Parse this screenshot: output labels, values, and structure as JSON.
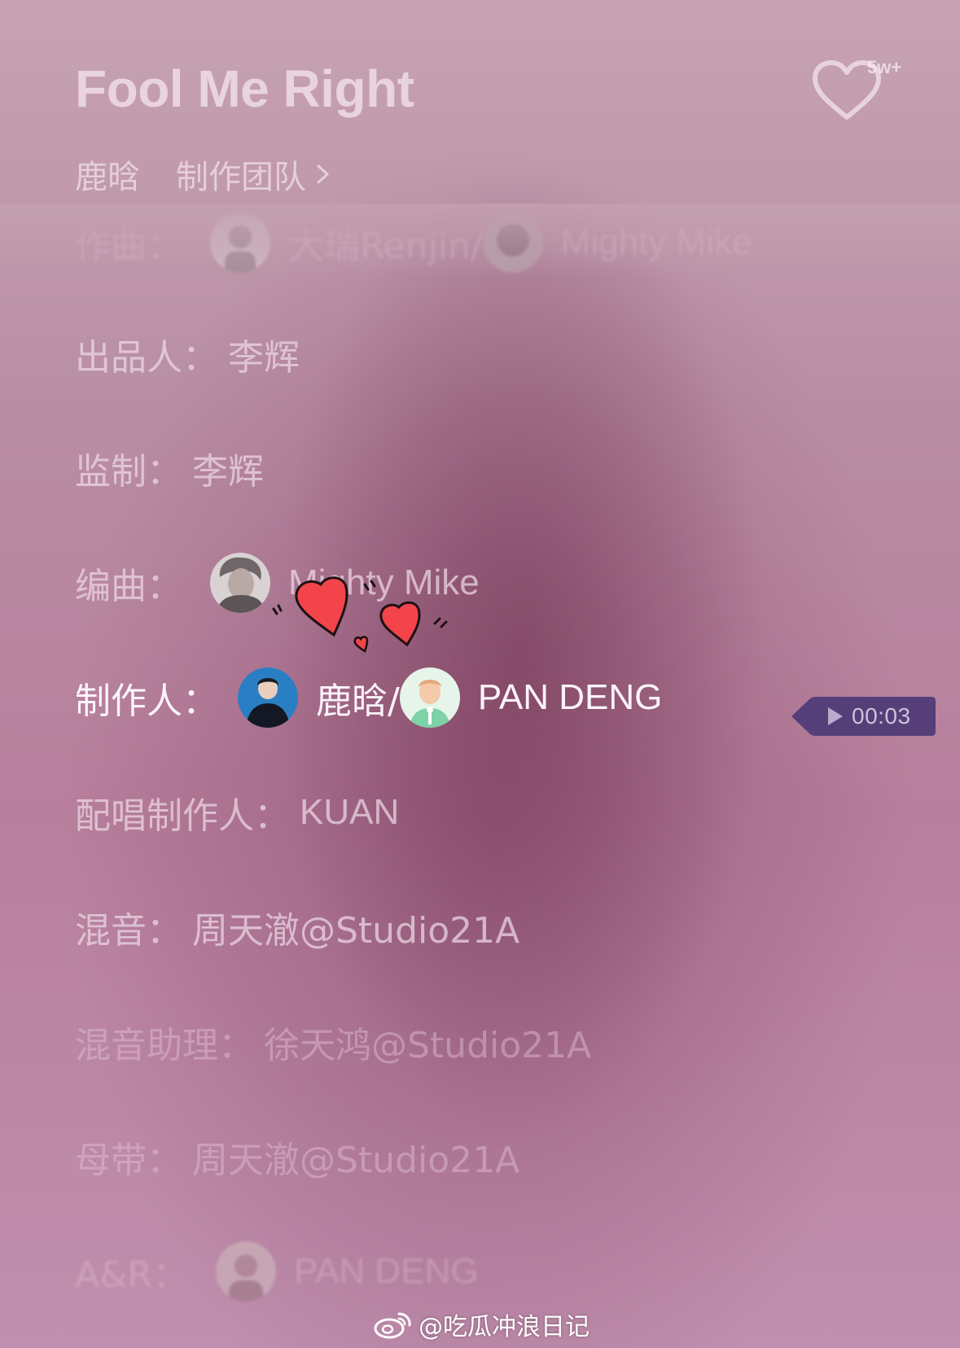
{
  "song": {
    "title": "Fool Me Right",
    "artist": "鹿晗",
    "team_link": "制作团队",
    "likes": "5w+"
  },
  "credits": {
    "composer": {
      "label": "作曲：",
      "value": "大瑞Renjin/",
      "value2": "Mighty Mike"
    },
    "producer_exec": {
      "label": "出品人：",
      "value": "李辉"
    },
    "supervisor": {
      "label": "监制：",
      "value": "李辉"
    },
    "arranger": {
      "label": "编曲：",
      "value": "Mighty Mike"
    },
    "producer": {
      "label": "制作人：",
      "value": "鹿晗/",
      "value2": "PAN DENG"
    },
    "vocal_producer": {
      "label": "配唱制作人：",
      "value": "KUAN"
    },
    "mixing": {
      "label": "混音：",
      "value": "周天澈@Studio21A"
    },
    "mixing_assistant": {
      "label": "混音助理：",
      "value": "徐天鸿@Studio21A"
    },
    "mastering": {
      "label": "母带：",
      "value": "周天澈@Studio21A"
    },
    "anr": {
      "label": "A&R：",
      "value": "PAN DENG"
    }
  },
  "player": {
    "time_badge": "00:03"
  },
  "watermark": {
    "handle": "@吃瓜冲浪日记"
  },
  "colors": {
    "accent_badge": "#4d3a76",
    "text_active": "#fbf4fa",
    "hearts_red": "#f2444a"
  },
  "icons": [
    "heart-outline-icon",
    "chevron-right-icon",
    "play-icon",
    "weibo-logo-icon",
    "hearts-sticker"
  ]
}
